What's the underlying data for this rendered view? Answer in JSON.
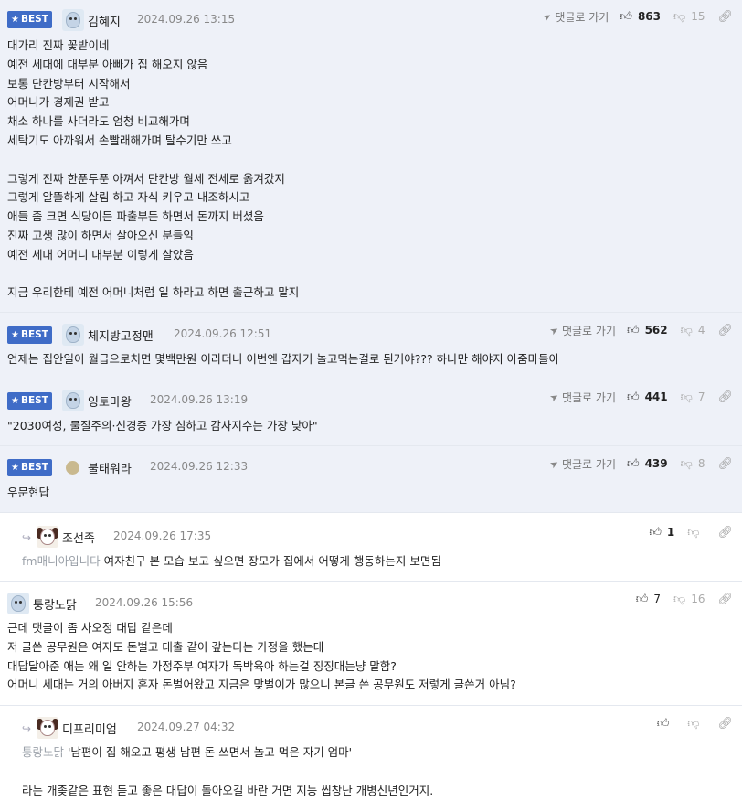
{
  "comments": [
    {
      "best": true,
      "best_label": "BEST",
      "nick": "김혜지",
      "date": "2024.09.26 13:15",
      "reply_label": "댓글로 가기",
      "up": "863",
      "down": "15",
      "lines": [
        "대가리 진짜 꽃밭이네",
        "예전 세대에 대부분 아빠가 집 해오지 않음",
        "보통 단칸방부터 시작해서",
        "어머니가 경제권 받고",
        "채소 하나를 사더라도 엄청 비교해가며",
        "세탁기도 아까워서 손빨래해가며 탈수기만 쓰고",
        "",
        "그렇게 진짜 한푼두푼 아껴서 단칸방 월세 전세로 옮겨갔지",
        "그렇게 알뜰하게 살림 하고 자식 키우고 내조하시고",
        "애들 좀 크면 식당이든 파출부든 하면서 돈까지 버셨음",
        "진짜 고생 많이 하면서 살아오신 분들임",
        "예전 세대 어머니 대부분 이렇게 살았음",
        "",
        "지금 우리한테 예전 어머니처럼 일 하라고 하면 출근하고 말지"
      ]
    },
    {
      "best": true,
      "best_label": "BEST",
      "nick": "체지방고정맨",
      "date": "2024.09.26 12:51",
      "reply_label": "댓글로 가기",
      "up": "562",
      "down": "4",
      "lines": [
        "언제는 집안일이 월급으로치면 몇백만원 이라더니 이번엔 갑자기 놀고먹는걸로 된거야??? 하나만 해야지 아줌마들아"
      ]
    },
    {
      "best": true,
      "best_label": "BEST",
      "nick": "잉토마왕",
      "date": "2024.09.26 13:19",
      "reply_label": "댓글로 가기",
      "up": "441",
      "down": "7",
      "lines": [
        "\"2030여성, 물질주의·신경증 가장 심하고 감사지수는 가장 낮아\""
      ]
    },
    {
      "best": true,
      "best_label": "BEST",
      "nick": "불태워라",
      "date": "2024.09.26 12:33",
      "reply_label": "댓글로 가기",
      "up": "439",
      "down": "8",
      "lines": [
        "우문현답"
      ]
    },
    {
      "reply": true,
      "nick": "조선족",
      "date": "2024.09.26 17:35",
      "up": "1",
      "down": "",
      "ref": "fm매니아입니다",
      "lines": [
        "여자친구 본 모습 보고 싶으면 장모가 집에서 어떻게 행동하는지 보면됨"
      ]
    },
    {
      "nick": "퉁랑노닭",
      "date": "2024.09.26 15:56",
      "up": "7",
      "down": "16",
      "lines": [
        "근데 댓글이 좀 사오정 대답 같은데",
        "저 글쓴 공무원은 여자도 돈벌고 대출 같이 갚는다는 가정을 했는데",
        "대답달아준 애는 왜 일 안하는 가정주부 여자가 독박육아 하는걸 징징대는냥 말함?",
        "어머니 세대는 거의 아버지 혼자 돈벌어왔고 지금은 맞벌이가 많으니 본글 쓴 공무원도 저렇게 글쓴거 아님?"
      ]
    },
    {
      "reply": true,
      "nick": "디프리미엄",
      "date": "2024.09.27 04:32",
      "up": "",
      "down": "",
      "ref": "퉁랑노닭",
      "lines": [
        "'남편이 집 해오고 평생 남편 돈 쓰면서 놀고 먹은 자기 엄마'",
        "",
        "라는 개좆같은 표현 듣고 좋은 대답이 돌아오길 바란 거면 지능 씹창난 개병신년인거지."
      ]
    }
  ]
}
